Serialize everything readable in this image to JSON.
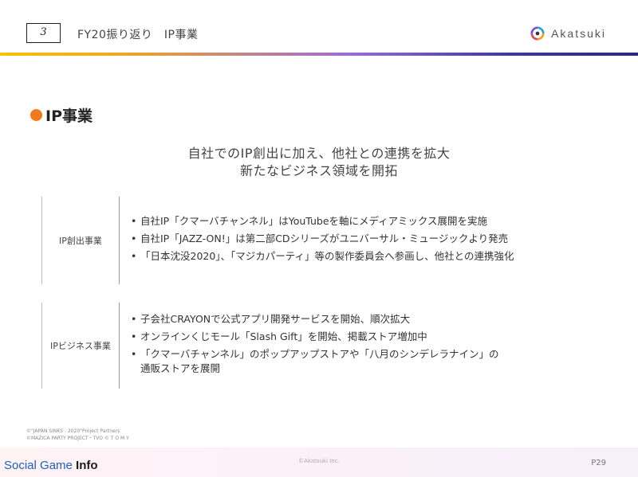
{
  "header": {
    "section_number": "3",
    "title": "FY20振り返り　IP事業",
    "logo_text": "Akatsuki"
  },
  "section_heading": "IP事業",
  "lead": {
    "line1": "自社でのIP創出に加え、他社との連携を拡大",
    "line2": "新たなビジネス領域を開拓"
  },
  "rows": [
    {
      "label": "IP創出事業",
      "items": [
        "自社IP「クマーバチャンネル」はYouTubeを軸にメディアミックス展開を実施",
        "自社IP「JAZZ-ON!」は第二部CDシリーズがユニバーサル・ミュージックより発売",
        "「日本沈没2020」、「マジカパーティ」等の製作委員会へ参画し、他社との連携強化"
      ]
    },
    {
      "label": "IPビジネス事業",
      "items": [
        "子会社CRAYONで公式アプリ開発サービスを開始、順次拡大",
        "オンラインくじモール「Slash Gift」を開始、掲載ストア増加中",
        "「クマーバチャンネル」のポップアップストアや「八月のシンデレラナイン」の",
        "通販ストアを展開"
      ]
    }
  ],
  "footer": {
    "copyright_1": "©\"JAPAN SINKS : 2020\"Project Partners",
    "copyright_2": "©MAZICA PARTY PROJECT・TVO © T O M Y",
    "center": "©Akatsuki Inc.",
    "page": "P29"
  },
  "watermark": {
    "part1": "Social Game ",
    "part2": "Info"
  },
  "colors": {
    "accent_orange": "#f07a1c",
    "watermark_blue": "#1f5fbf"
  }
}
